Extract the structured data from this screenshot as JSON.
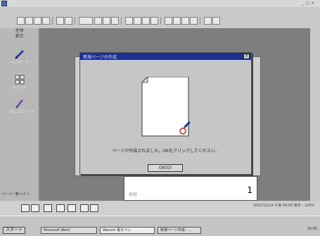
{
  "window": {
    "title": "",
    "controls": "_ □ ×"
  },
  "menubar": {
    "items": [
      "",
      "",
      "",
      "",
      "",
      "",
      "",
      ""
    ]
  },
  "sidebar": {
    "header_top": "全体",
    "header_mid": "表示",
    "tools": [
      {
        "icon": "pen-icon",
        "label": "ペン/マーカー"
      },
      {
        "icon": "grid-icon",
        "label": "グリッド"
      },
      {
        "icon": "eraser-icon",
        "label": "消しゴムツール"
      }
    ],
    "bottom_label": "ページ一覧ペイン"
  },
  "dialog": {
    "title": "新規ページの作成",
    "close_glyph": "×",
    "message": "ページが作成されました。OKをクリックしてください。",
    "ok_label": "OK(O)"
  },
  "page": {
    "number": "1",
    "small_label": "表紙"
  },
  "statusbar": {
    "info": "2001/12/14 午後 04:00   表示 : 100%"
  },
  "taskbar": {
    "start_label": "スタート",
    "tasks": [
      "Microsoft Word",
      "Wacom 電子ペン",
      "新規ページ作成 - ..."
    ],
    "date_text": "",
    "tray_text": "16:00"
  },
  "colors": {
    "dialog_title": "#1c2f8e",
    "canvas": "#7e7e7e",
    "accent_red": "#d02020"
  }
}
